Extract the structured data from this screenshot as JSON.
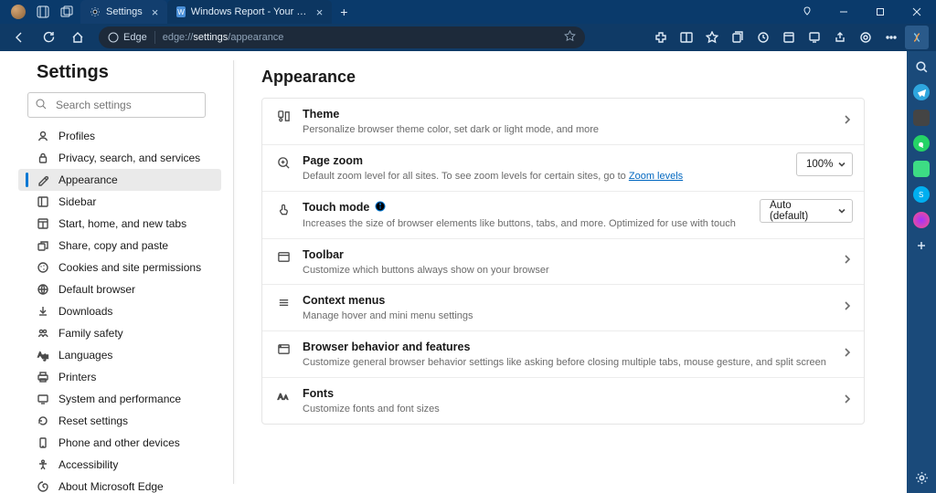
{
  "titlebar": {
    "tabs": [
      {
        "label": "Settings"
      },
      {
        "label": "Windows Report - Your go-to sou"
      }
    ]
  },
  "toolbar": {
    "edge_label": "Edge",
    "url_prefix": "edge://",
    "url_page": "settings",
    "url_path": "/appearance"
  },
  "settings": {
    "heading": "Settings",
    "search_placeholder": "Search settings",
    "nav": [
      {
        "id": "profiles",
        "label": "Profiles"
      },
      {
        "id": "privacy",
        "label": "Privacy, search, and services"
      },
      {
        "id": "appearance",
        "label": "Appearance",
        "selected": true
      },
      {
        "id": "sidebar",
        "label": "Sidebar"
      },
      {
        "id": "start",
        "label": "Start, home, and new tabs"
      },
      {
        "id": "share",
        "label": "Share, copy and paste"
      },
      {
        "id": "cookies",
        "label": "Cookies and site permissions"
      },
      {
        "id": "default",
        "label": "Default browser"
      },
      {
        "id": "downloads",
        "label": "Downloads"
      },
      {
        "id": "family",
        "label": "Family safety"
      },
      {
        "id": "languages",
        "label": "Languages"
      },
      {
        "id": "printers",
        "label": "Printers"
      },
      {
        "id": "system",
        "label": "System and performance"
      },
      {
        "id": "reset",
        "label": "Reset settings"
      },
      {
        "id": "phone",
        "label": "Phone and other devices"
      },
      {
        "id": "accessibility",
        "label": "Accessibility"
      },
      {
        "id": "about",
        "label": "About Microsoft Edge"
      }
    ]
  },
  "detail": {
    "title": "Appearance",
    "rows": {
      "theme": {
        "title": "Theme",
        "sub": "Personalize browser theme color, set dark or light mode, and more"
      },
      "zoom": {
        "title": "Page zoom",
        "sub_a": "Default zoom level for all sites. To see zoom levels for certain sites, go to ",
        "sub_link": "Zoom levels",
        "value": "100%"
      },
      "touch": {
        "title": "Touch mode",
        "sub": "Increases the size of browser elements like buttons, tabs, and more. Optimized for use with touch",
        "value": "Auto (default)"
      },
      "toolbar": {
        "title": "Toolbar",
        "sub": "Customize which buttons always show on your browser"
      },
      "context": {
        "title": "Context menus",
        "sub": "Manage hover and mini menu settings"
      },
      "behavior": {
        "title": "Browser behavior and features",
        "sub": "Customize general browser behavior settings like asking before closing multiple tabs, mouse gesture, and split screen"
      },
      "fonts": {
        "title": "Fonts",
        "sub": "Customize fonts and font sizes"
      }
    }
  }
}
